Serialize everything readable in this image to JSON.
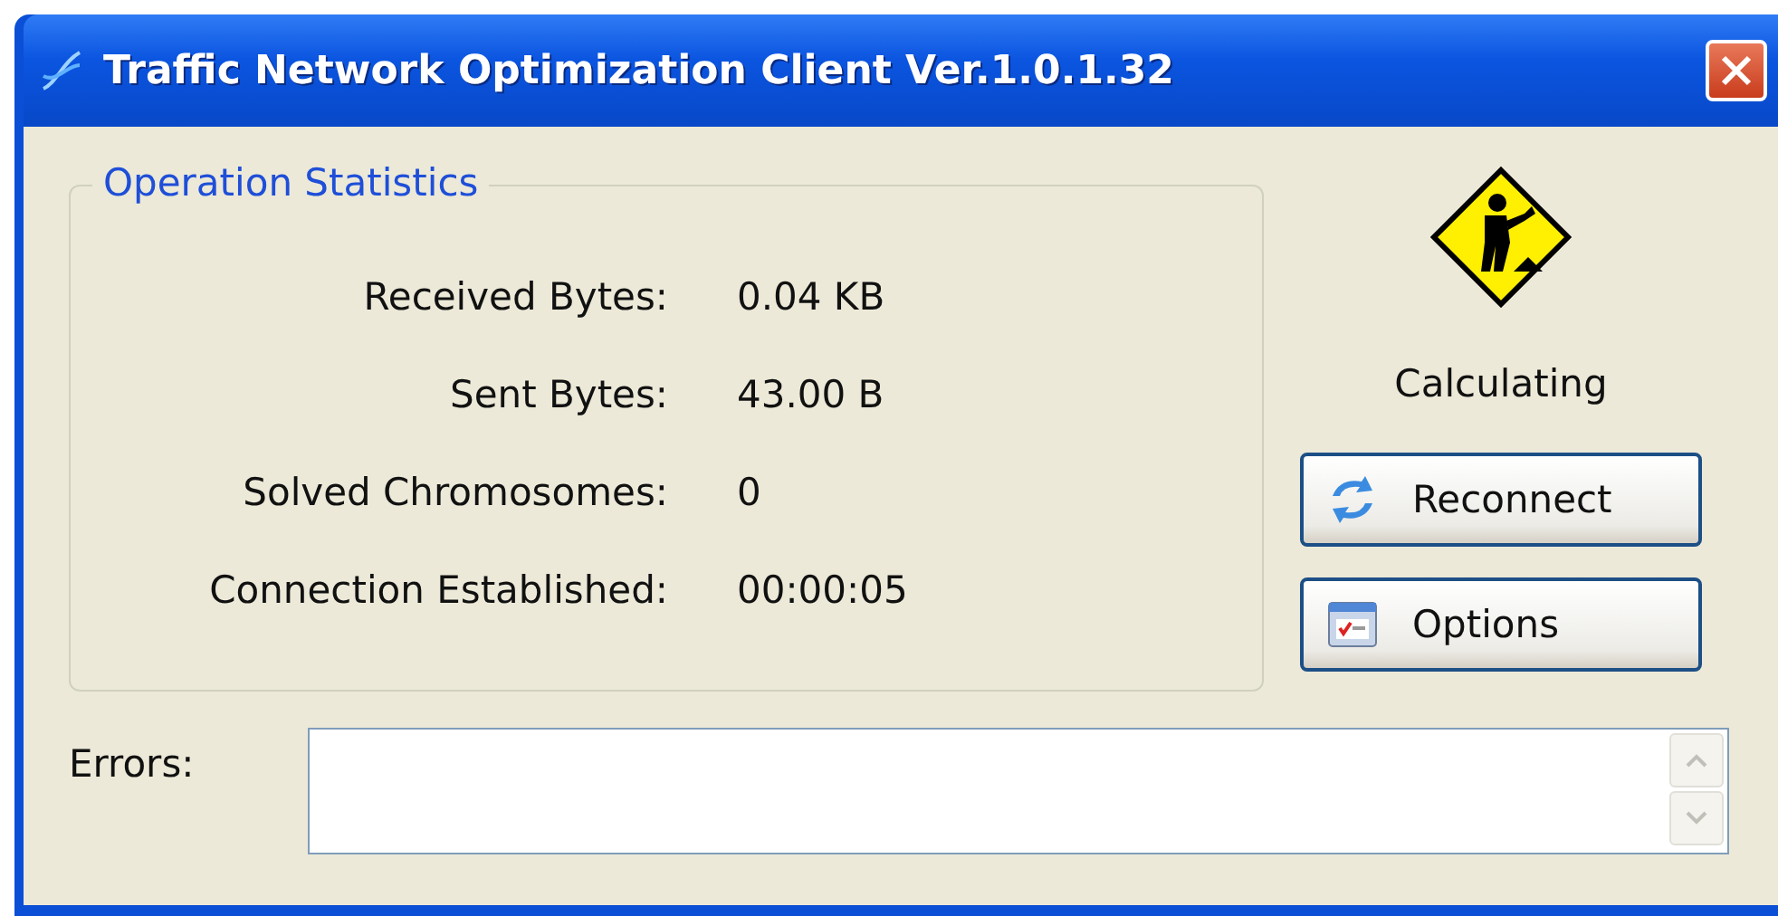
{
  "window": {
    "title": "Traffic Network Optimization Client Ver.1.0.1.32"
  },
  "statistics": {
    "title": "Operation Statistics",
    "rows": [
      {
        "label": "Received Bytes:",
        "value": "0.04 KB"
      },
      {
        "label": "Sent Bytes:",
        "value": "43.00 B"
      },
      {
        "label": "Solved Chromosomes:",
        "value": "0"
      },
      {
        "label": "Connection Established:",
        "value": "00:00:05"
      }
    ]
  },
  "status": "Calculating",
  "buttons": [
    {
      "kind": "reconnect",
      "label": "Reconnect"
    },
    {
      "kind": "options",
      "label": "Options"
    }
  ],
  "errors": {
    "label": "Errors:"
  }
}
